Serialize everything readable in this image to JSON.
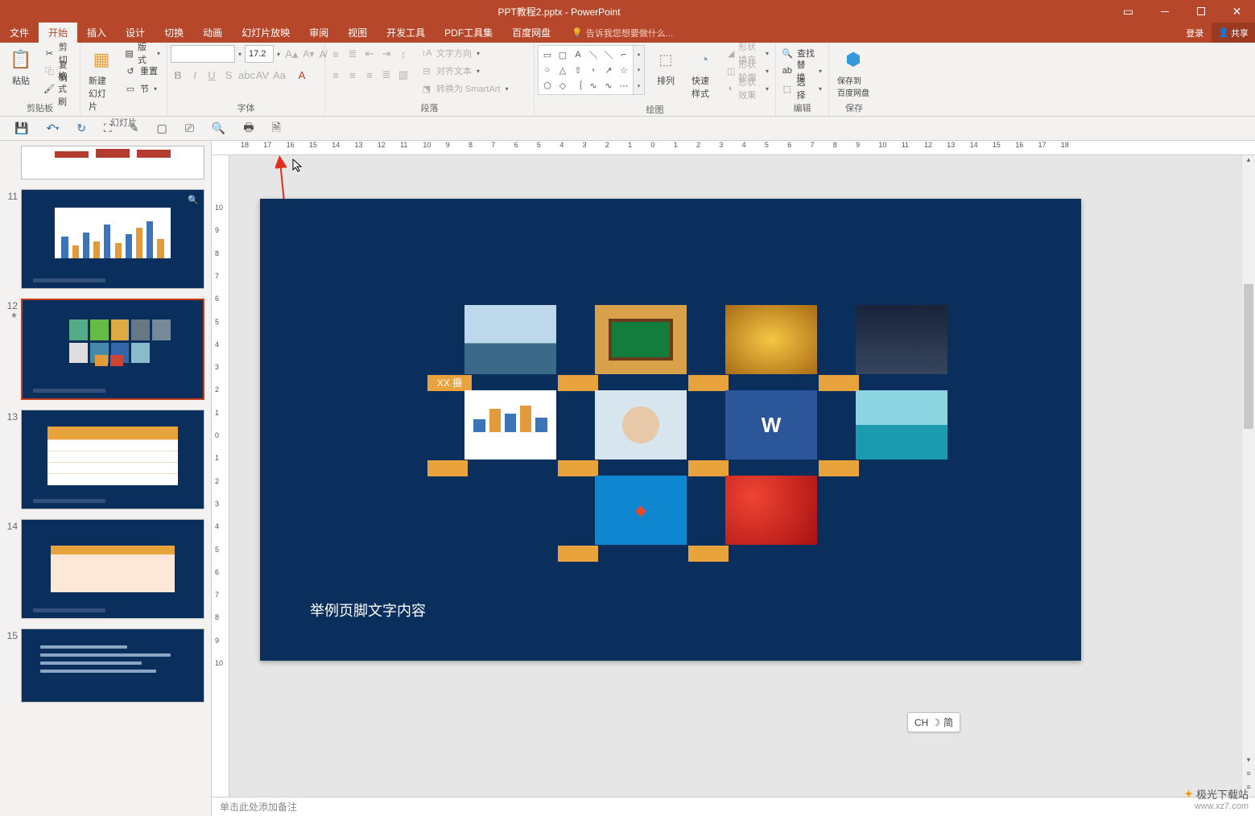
{
  "titlebar": {
    "title": "PPT教程2.pptx - PowerPoint"
  },
  "menu": {
    "items": [
      "文件",
      "开始",
      "插入",
      "设计",
      "切换",
      "动画",
      "幻灯片放映",
      "审阅",
      "视图",
      "开发工具",
      "PDF工具集",
      "百度网盘"
    ],
    "active_index": 1,
    "tell_me": "告诉我您想要做什么...",
    "login": "登录",
    "share": "共享"
  },
  "ribbon": {
    "clipboard": {
      "paste": "粘贴",
      "cut": "剪切",
      "copy": "复制",
      "format_painter": "格式刷",
      "label": "剪贴板"
    },
    "slides": {
      "new_slide": "新建\n幻灯片",
      "layout": "版式",
      "reset": "重置",
      "section": "节",
      "label": "幻灯片"
    },
    "font": {
      "label": "字体",
      "size": "17.2"
    },
    "paragraph": {
      "label": "段落",
      "text_direction": "文字方向",
      "align_text": "对齐文本",
      "smartart": "转换为 SmartArt"
    },
    "drawing": {
      "label": "绘图",
      "arrange": "排列",
      "quick_styles": "快速样式",
      "shape_fill": "形状填充",
      "shape_outline": "形状轮廓",
      "shape_effects": "形状效果"
    },
    "editing": {
      "label": "编辑",
      "find": "查找",
      "replace": "替换",
      "select": "选择"
    },
    "save": {
      "label": "保存",
      "save_to": "保存到\n百度网盘"
    }
  },
  "thumbs": {
    "visible": [
      {
        "num": "",
        "kind": "partial-top"
      },
      {
        "num": "11",
        "kind": "chart"
      },
      {
        "num": "12",
        "kind": "grid",
        "selected": true,
        "starred": true
      },
      {
        "num": "13",
        "kind": "table"
      },
      {
        "num": "14",
        "kind": "table2"
      },
      {
        "num": "15",
        "kind": "text"
      }
    ]
  },
  "slide": {
    "label_first": "XX 摄",
    "footer": "举例页脚文字内容"
  },
  "notes_placeholder": "单击此处添加备注",
  "ime": {
    "lang": "CH",
    "mode": "简"
  },
  "watermark": {
    "name": "极光下载站",
    "url": "www.xz7.com"
  },
  "ruler_h": [
    18,
    17,
    16,
    15,
    14,
    13,
    12,
    11,
    10,
    9,
    8,
    7,
    6,
    5,
    4,
    3,
    2,
    1,
    0,
    1,
    2,
    3,
    4,
    5,
    6,
    7,
    8,
    9,
    10,
    11,
    12,
    13,
    14,
    15,
    16,
    17,
    18
  ],
  "ruler_v": [
    10,
    9,
    8,
    7,
    6,
    5,
    4,
    3,
    2,
    1,
    0,
    1,
    2,
    3,
    4,
    5,
    6,
    7,
    8,
    9,
    10
  ]
}
